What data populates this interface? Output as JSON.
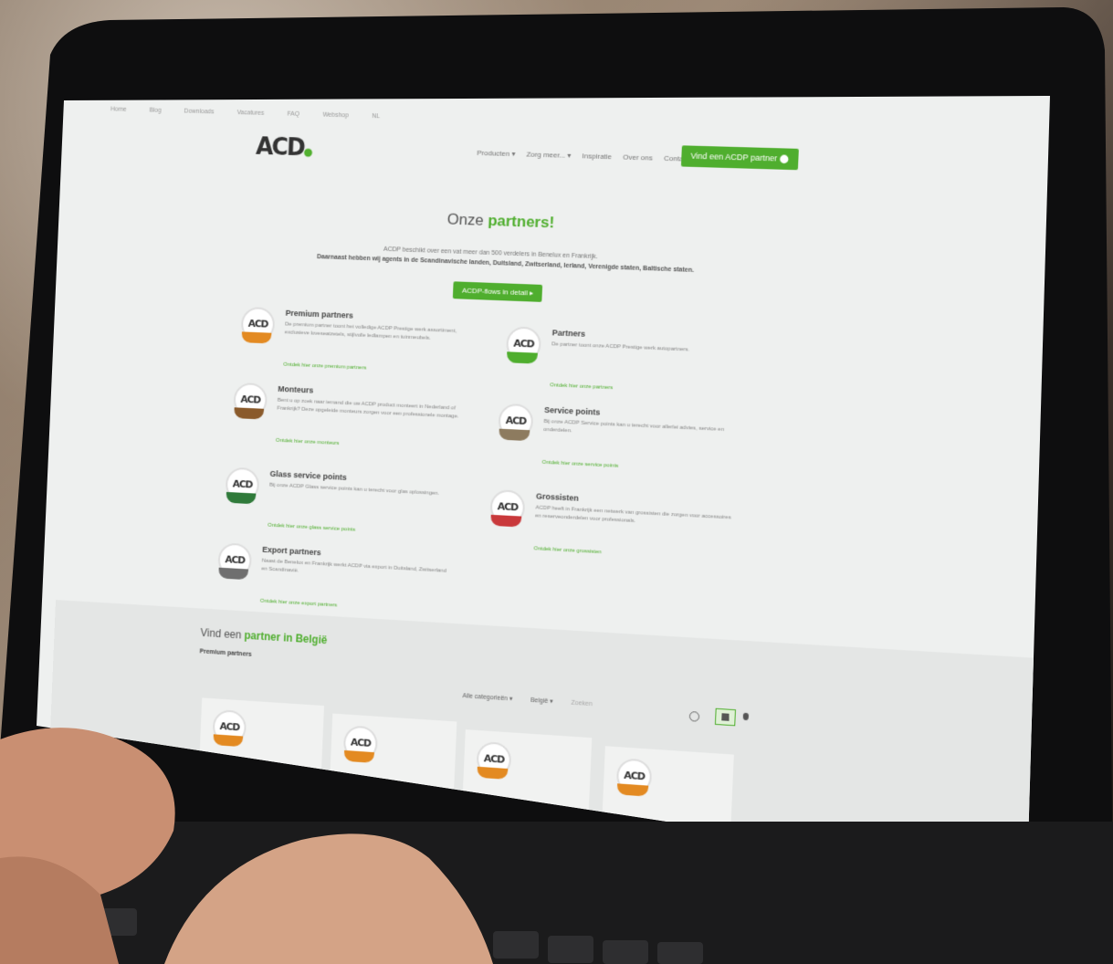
{
  "topbar": {
    "items": [
      "Home",
      "Blog",
      "Downloads",
      "Vacatures",
      "FAQ",
      "Webshop",
      "NL"
    ]
  },
  "header": {
    "logo_text": "ACD",
    "nav": [
      "Producten ▾",
      "Zorg meer... ▾",
      "Inspiratie",
      "Over ons",
      "Contact"
    ],
    "cta_label": "Vind een ACDP partner"
  },
  "hero": {
    "title_prefix": "Onze",
    "title_highlight": "partners!",
    "intro_line1": "ACDP beschikt over een vat meer dan 500 verdelers in Benelux en Frankrijk.",
    "intro_line2": "Daarnaast hebben wij agents in de Scandinavische landen, Duitsland, Zwitserland, Ierland, Verenigde staten, Baltische staten.",
    "button_label": "ACDP-flows in detail"
  },
  "categories": [
    {
      "title": "Premium partners",
      "desc": "De premium partner toont het volledige ACDP Prestige werk assortiment, exclusieve loveseatzetels, stijlvolle ledlampen en tuinmeubels.",
      "link": "Ontdek hier onze premium partners",
      "band": "#e38a22"
    },
    {
      "title": "Partners",
      "desc": "De partner toont onze ACDP Prestige werk autopartners.",
      "link": "Ontdek hier onze partners",
      "band": "#4fae2e"
    },
    {
      "title": "Monteurs",
      "desc": "Bent u op zoek naar iemand die uw ACDP product monteert in Nederland of Frankrijk? Deze opgeleide monteurs zorgen voor een professionele montage.",
      "link": "Ontdek hier onze monteurs",
      "band": "#8a5a2b"
    },
    {
      "title": "Service points",
      "desc": "Bij onze ACDP Service points kan u terecht voor allerlei advies, service en onderdelen.",
      "link": "Ontdek hier onze service points",
      "band": "#8d7b5f"
    },
    {
      "title": "Glass service points",
      "desc": "Bij onze ACDP Glass service points kan u terecht voor glas oplossingen.",
      "link": "Ontdek hier onze glass service points",
      "band": "#2f7a3a"
    },
    {
      "title": "Grossisten",
      "desc": "ACDP heeft in Frankrijk een netwerk van grossisten die zorgen voor accessoires en reserveonderdelen voor professionals.",
      "link": "Ontdek hier onze grossisten",
      "band": "#c9393b"
    },
    {
      "title": "Export partners",
      "desc": "Naast de Benelux en Frankrijk werkt ACDP via export in Duitsland, Zwitserland en Scandinavië.",
      "link": "Ontdek hier onze export partners",
      "band": "#6f6f6f"
    }
  ],
  "finder": {
    "title_prefix": "Vind een",
    "title_highlight": "partner in België",
    "subtitle": "Premium partners",
    "filter_category": "Alle categorieën ▾",
    "filter_country": "België ▾",
    "filter_search": "Zoeken"
  },
  "cards": [
    {
      "badge": "ACD"
    },
    {
      "badge": "ACD"
    },
    {
      "badge": "ACD"
    },
    {
      "badge": "ACD"
    }
  ],
  "colors": {
    "accent": "#4fae2e",
    "text": "#555555"
  }
}
